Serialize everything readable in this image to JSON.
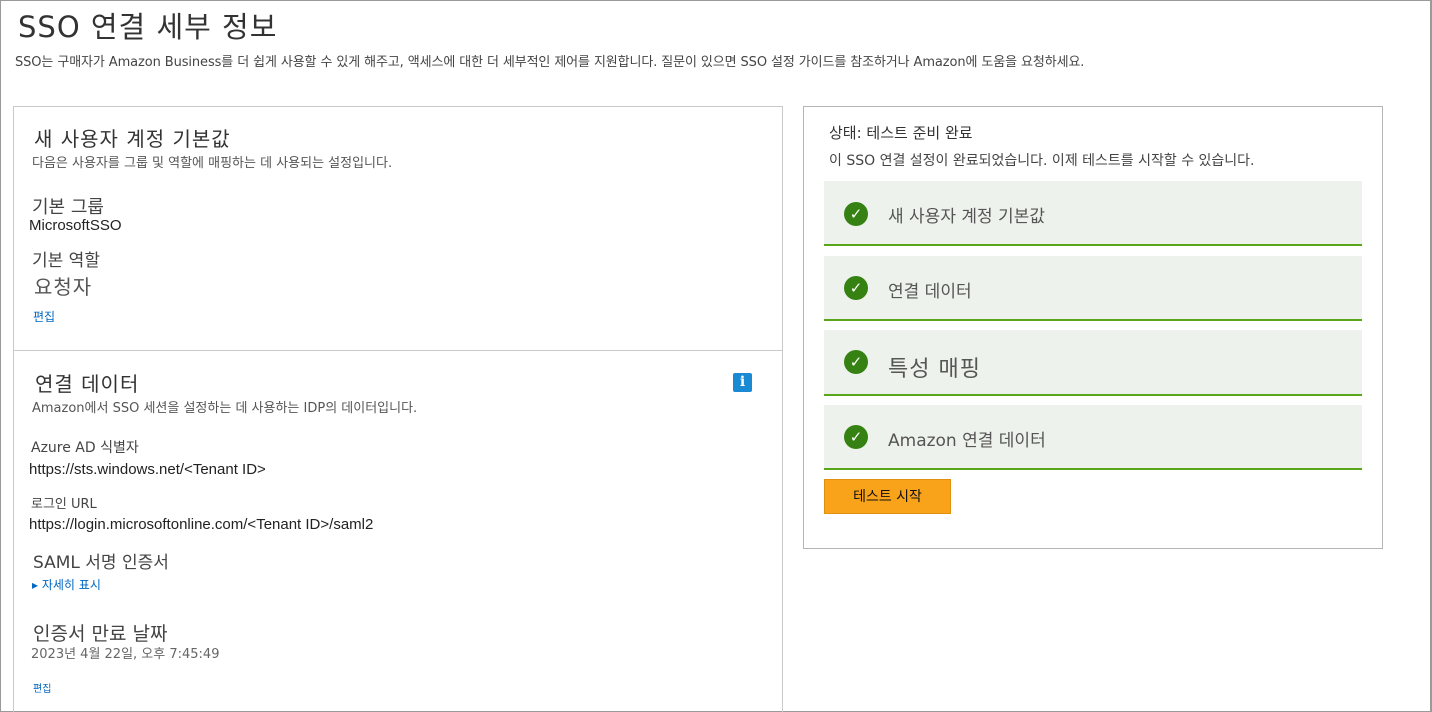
{
  "header": {
    "title": "SSO 연결 세부 정보",
    "description": "SSO는 구매자가 Amazon  Business를 더 쉽게 사용할 수 있게 해주고, 액세스에 대한 더 세부적인 제어를 지원합니다. 질문이 있으면 SSO 설정 가이드를 참조하거나 Amazon에 도움을 요청하세요."
  },
  "account_defaults": {
    "title": "새 사용자 계정 기본값",
    "description": "다음은 사용자를 그룹 및 역할에 매핑하는 데 사용되는 설정입니다.",
    "group_label": "기본 그룹",
    "group_value": "MicrosoftSSO",
    "role_label": "기본 역할",
    "role_value": "요청자",
    "edit_label": "편집"
  },
  "connection_data": {
    "title": "연결 데이터",
    "description": "Amazon에서 SSO 세션을 설정하는 데 사용하는 IDP의 데이터입니다.",
    "info_icon": "i",
    "azure_label": "Azure AD 식별자",
    "azure_value": "https://sts.windows.net/<Tenant ID>",
    "login_label": "로그인 URL",
    "login_value": "https://login.microsoftonline.com/<Tenant ID>/saml2",
    "saml_label": "SAML 서명 인증서",
    "show_details": "▸ 자세히 표시",
    "expiry_label": "인증서 만료 날짜",
    "expiry_value": "2023년 4월 22일, 오후 7:45:49",
    "edit_label": "편집"
  },
  "status": {
    "title": "상태: 테스트 준비 완료",
    "description": "이 SSO 연결 설정이 완료되었습니다. 이제 테스트를 시작할 수 있습니다.",
    "steps": [
      {
        "label": "새 사용자 계정 기본값",
        "state": "complete"
      },
      {
        "label": "연결 데이터",
        "state": "complete"
      },
      {
        "label": "특성 매핑",
        "state": "complete"
      },
      {
        "label": "Amazon 연결 데이터",
        "state": "complete"
      }
    ],
    "check_glyph": "✓",
    "start_button": "테스트 시작"
  },
  "colors": {
    "accent_orange": "#f9a31b",
    "success_green": "#358212",
    "step_border_green": "#5aa619",
    "step_background": "#eef2ec",
    "link_blue": "#0066c0",
    "info_blue": "#1a8ad4"
  }
}
